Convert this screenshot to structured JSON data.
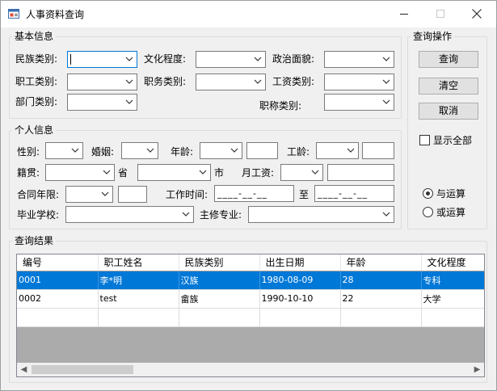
{
  "window": {
    "title": "人事资料查询",
    "min_icon": "minimize-icon",
    "max_icon": "maximize-icon",
    "close_icon": "close-icon"
  },
  "basic": {
    "title": "基本信息",
    "ethnicity": {
      "label": "民族类别:",
      "value": ""
    },
    "education": {
      "label": "文化程度:",
      "value": ""
    },
    "political": {
      "label": "政治面貌:",
      "value": ""
    },
    "staff_type": {
      "label": "职工类别:",
      "value": ""
    },
    "position_type": {
      "label": "职务类别:",
      "value": ""
    },
    "wage_type": {
      "label": "工资类别:",
      "value": ""
    },
    "department": {
      "label": "部门类别:",
      "value": ""
    },
    "title_type": {
      "label": "职称类别:",
      "value": ""
    }
  },
  "ops": {
    "title": "查询操作",
    "query": "查询",
    "clear": "清空",
    "cancel": "取消",
    "show_all": {
      "label": "显示全部",
      "checked": false
    },
    "and_op": {
      "label": "与运算",
      "selected": true
    },
    "or_op": {
      "label": "或运算",
      "selected": false
    }
  },
  "personal": {
    "title": "个人信息",
    "gender": {
      "label": "性别:",
      "value": ""
    },
    "marriage": {
      "label": "婚姻:",
      "value": ""
    },
    "age": {
      "label": "年龄:",
      "value": ""
    },
    "seniority": {
      "label": "工龄:",
      "value": ""
    },
    "native": {
      "label": "籍贯:",
      "province_suffix": "省",
      "city_suffix": "市"
    },
    "salary": {
      "label": "月工资:",
      "value": ""
    },
    "contract": {
      "label": "合同年限:",
      "value": ""
    },
    "work_time": {
      "label": "工作时间:",
      "from": "____-__-__",
      "to_label": "至",
      "to": "____-__-__"
    },
    "school": {
      "label": "毕业学校:",
      "value": ""
    },
    "major": {
      "label": "主修专业:",
      "value": ""
    }
  },
  "results": {
    "title": "查询结果",
    "columns": [
      "编号",
      "职工姓名",
      "民族类别",
      "出生日期",
      "年龄",
      "文化程度"
    ],
    "rows": [
      [
        "0001",
        "李*明",
        "汉族",
        "1980-08-09",
        "28",
        "专科"
      ],
      [
        "0002",
        "test",
        "畲族",
        "1990-10-10",
        "22",
        "大学"
      ],
      [
        "",
        "",
        "",
        "",
        "",
        ""
      ]
    ],
    "selected_row": 0
  }
}
